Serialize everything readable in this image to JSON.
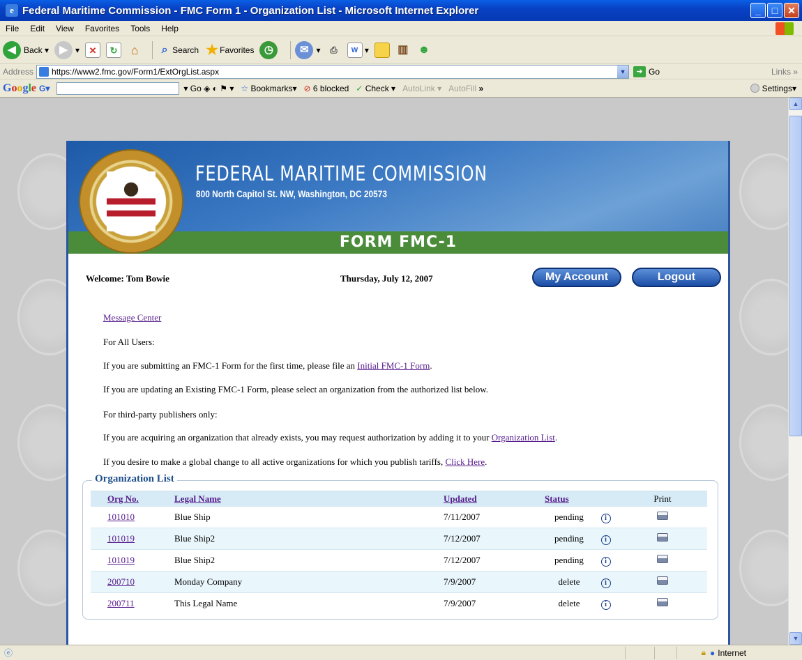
{
  "window": {
    "title": "Federal Maritime Commission - FMC Form 1 - Organization List - Microsoft Internet Explorer"
  },
  "menu": [
    "File",
    "Edit",
    "View",
    "Favorites",
    "Tools",
    "Help"
  ],
  "toolbar": {
    "back": "Back",
    "search": "Search",
    "favorites": "Favorites"
  },
  "address": {
    "label": "Address",
    "url": "https://www2.fmc.gov/Form1/ExtOrgList.aspx",
    "go": "Go",
    "links": "Links"
  },
  "google": {
    "go": "Go",
    "bookmarks": "Bookmarks",
    "blocked": "6 blocked",
    "check": "Check",
    "autolink": "AutoLink",
    "autofill": "AutoFill",
    "settings": "Settings"
  },
  "header": {
    "title": "FEDERAL MARITIME COMMISSION",
    "address": "800 North Capitol St. NW, Washington, DC 20573",
    "form": "FORM FMC-1"
  },
  "user": {
    "welcome": "Welcome: Tom Bowie",
    "date": "Thursday, July 12, 2007",
    "my_account": "My Account",
    "logout": "Logout"
  },
  "content": {
    "message_center": "Message Center",
    "for_all": "For All Users:",
    "line1_pre": "If you are submitting an FMC-1 Form for the first time, please file an ",
    "line1_link": "Initial FMC-1 Form",
    "line1_post": ".",
    "line2": "If you are updating an Existing FMC-1 Form, please select an organization from the authorized list below.",
    "third_party": "For third-party publishers only:",
    "line3_pre": "If you are acquiring an organization that already exists, you may request authorization by adding it to your ",
    "line3_link": "Organization List",
    "line3_post": ".",
    "line4_pre": "If you desire to make a global change to all active organizations for which you publish tariffs, ",
    "line4_link": "Click Here",
    "line4_post": "."
  },
  "org_list": {
    "legend": "Organization List",
    "headers": {
      "org": "Org No.",
      "name": "Legal Name",
      "updated": "Updated",
      "status": "Status",
      "print": "Print"
    },
    "rows": [
      {
        "org": "101010",
        "name": "Blue Ship",
        "updated": "7/11/2007",
        "status": "pending"
      },
      {
        "org": "101019",
        "name": "Blue Ship2",
        "updated": "7/12/2007",
        "status": "pending"
      },
      {
        "org": "101019",
        "name": "Blue Ship2",
        "updated": "7/12/2007",
        "status": "pending"
      },
      {
        "org": "200710",
        "name": "Monday Company",
        "updated": "7/9/2007",
        "status": "delete"
      },
      {
        "org": "200711",
        "name": "This Legal Name",
        "updated": "7/9/2007",
        "status": "delete"
      }
    ]
  },
  "status": {
    "zone": "Internet"
  }
}
